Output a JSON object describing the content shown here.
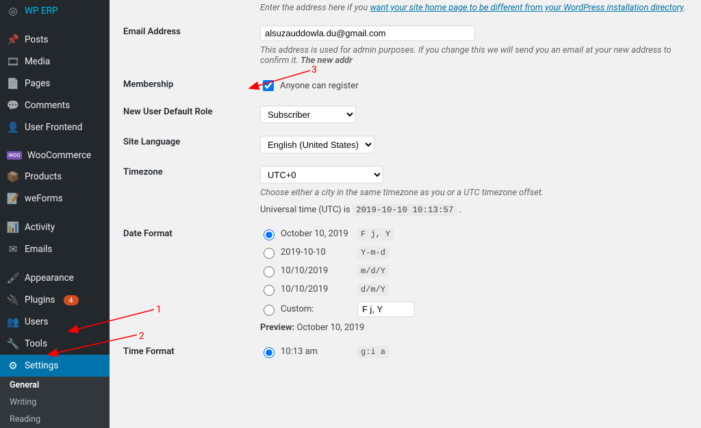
{
  "sidebar": {
    "items": [
      {
        "label": "WP ERP",
        "icon": "◎"
      },
      {
        "label": "Posts",
        "icon": "📌"
      },
      {
        "label": "Media",
        "icon": "🖼"
      },
      {
        "label": "Pages",
        "icon": "📄"
      },
      {
        "label": "Comments",
        "icon": "💬"
      },
      {
        "label": "User Frontend",
        "icon": "👤"
      },
      {
        "label": "WooCommerce",
        "icon": "woo"
      },
      {
        "label": "Products",
        "icon": "📦"
      },
      {
        "label": "weForms",
        "icon": "📝"
      },
      {
        "label": "Activity",
        "icon": "📊"
      },
      {
        "label": "Emails",
        "icon": "✉"
      },
      {
        "label": "Appearance",
        "icon": "🖌"
      },
      {
        "label": "Plugins",
        "icon": "🔌",
        "badge": "4"
      },
      {
        "label": "Users",
        "icon": "👥"
      },
      {
        "label": "Tools",
        "icon": "🔧"
      },
      {
        "label": "Settings",
        "icon": "⚙"
      }
    ],
    "sub": [
      "General",
      "Writing",
      "Reading"
    ]
  },
  "settings": {
    "address_hint_pre": "Enter the address here if you ",
    "address_hint_link": "want your site home page to be different from your WordPress installation directory",
    "email_label": "Email Address",
    "email_value": "alsuzauddowla.du@gmail.com",
    "email_desc": "This address is used for admin purposes. If you change this we will send you an email at your new address to confirm it. ",
    "email_desc_bold": "The new addr",
    "membership_label": "Membership",
    "membership_checkbox": "Anyone can register",
    "role_label": "New User Default Role",
    "role_value": "Subscriber",
    "lang_label": "Site Language",
    "lang_value": "English (United States)",
    "tz_label": "Timezone",
    "tz_value": "UTC+0",
    "tz_desc": "Choose either a city in the same timezone as you or a UTC timezone offset.",
    "utc_pre": "Universal time (UTC) is ",
    "utc_time": "2019-10-10 10:13:57",
    "dateformat_label": "Date Format",
    "date_opts": [
      {
        "label": "October 10, 2019",
        "code": "F j, Y",
        "checked": true
      },
      {
        "label": "2019-10-10",
        "code": "Y-m-d"
      },
      {
        "label": "10/10/2019",
        "code": "m/d/Y"
      },
      {
        "label": "10/10/2019",
        "code": "d/m/Y"
      }
    ],
    "date_custom_label": "Custom:",
    "date_custom_value": "F j, Y",
    "date_preview_label": "Preview:",
    "date_preview_value": "October 10, 2019",
    "timeformat_label": "Time Format",
    "time_opt_label": "10:13 am",
    "time_opt_code": "g:i a"
  },
  "annotations": {
    "one": "1",
    "two": "2",
    "three": "3"
  }
}
